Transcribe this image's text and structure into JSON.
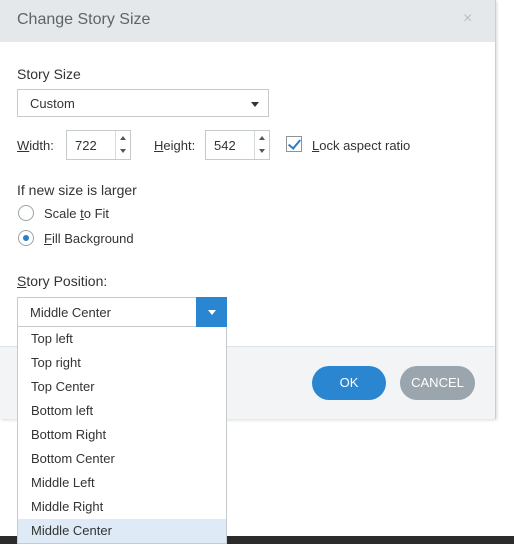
{
  "dialog": {
    "title": "Change Story Size",
    "close_label": "×"
  },
  "story_size": {
    "label": "Story Size",
    "selected": "Custom"
  },
  "dimensions": {
    "width_label_pre": "W",
    "width_label_rest": "idth:",
    "width_value": "722",
    "height_label_pre": "H",
    "height_label_rest": "eight:",
    "height_value": "542",
    "lock_pre": "L",
    "lock_rest": "ock aspect ratio",
    "lock_checked": true
  },
  "larger": {
    "label": "If new size is larger",
    "scale_pre": "Scale ",
    "scale_u": "t",
    "scale_post": "o Fit",
    "fill_pre": "F",
    "fill_rest": "ill Background",
    "selected": "Fill Background"
  },
  "position": {
    "label_pre": "S",
    "label_rest": "tory Position:",
    "selected": "Middle Center",
    "options": [
      "Top left",
      "Top right",
      "Top Center",
      "Bottom left",
      "Bottom Right",
      "Bottom Center",
      "Middle Left",
      "Middle Right",
      "Middle Center"
    ]
  },
  "buttons": {
    "ok": "OK",
    "cancel": "CANCEL"
  },
  "colors": {
    "accent": "#2a86d1",
    "cancel": "#9aa5ad",
    "title_bar": "#e4e8eb",
    "selected_option": "#deebf7"
  }
}
